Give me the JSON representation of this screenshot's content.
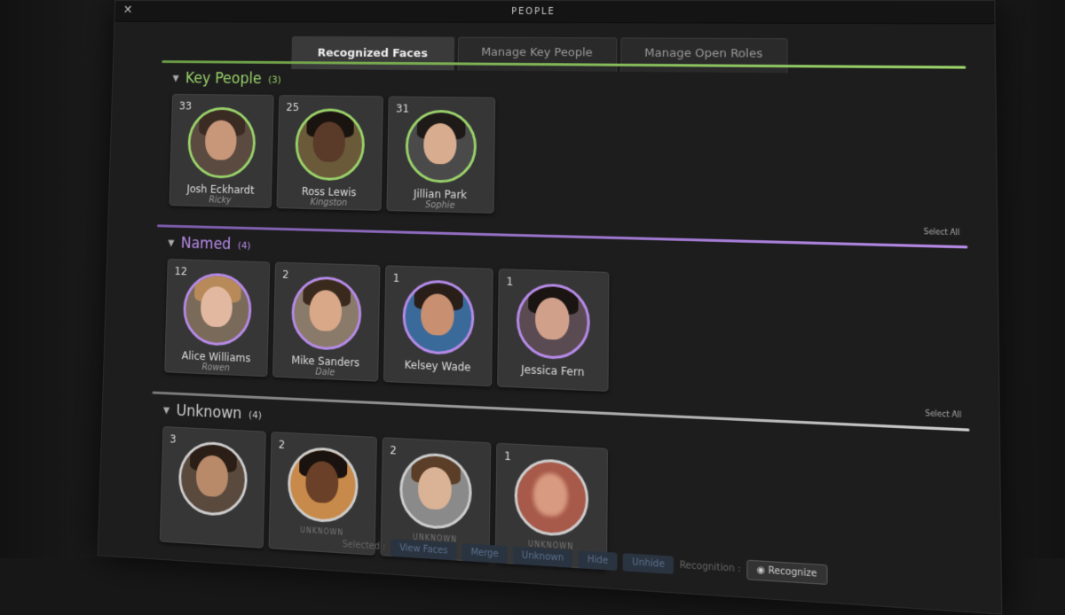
{
  "window": {
    "title": "PEOPLE",
    "close_label": "✕"
  },
  "tabs": [
    {
      "label": "Recognized Faces",
      "active": true
    },
    {
      "label": "Manage Key People",
      "active": false
    },
    {
      "label": "Manage Open Roles",
      "active": false
    }
  ],
  "sections": {
    "key_people": {
      "label": "Key People",
      "count": "(3)",
      "select_all": "Select All",
      "color": "#9ad36a",
      "cards": [
        {
          "count": "33",
          "name": "Josh Eckhardt",
          "alias": "Ricky"
        },
        {
          "count": "25",
          "name": "Ross Lewis",
          "alias": "Kingston"
        },
        {
          "count": "31",
          "name": "Jillian Park",
          "alias": "Sophie"
        }
      ]
    },
    "named": {
      "label": "Named",
      "count": "(4)",
      "select_all": "Select All",
      "color": "#b68ae8",
      "cards": [
        {
          "count": "12",
          "name": "Alice Williams",
          "alias": "Rowen"
        },
        {
          "count": "2",
          "name": "Mike Sanders",
          "alias": "Dale"
        },
        {
          "count": "1",
          "name": "Kelsey Wade",
          "alias": ""
        },
        {
          "count": "1",
          "name": "Jessica Fern",
          "alias": ""
        }
      ]
    },
    "unknown": {
      "label": "Unknown",
      "count": "(4)",
      "color": "#cccccc",
      "cards": [
        {
          "count": "3",
          "name": "",
          "alias": ""
        },
        {
          "count": "2",
          "name": "UNKNOWN",
          "alias": ""
        },
        {
          "count": "2",
          "name": "UNKNOWN",
          "alias": ""
        },
        {
          "count": "1",
          "name": "UNKNOWN",
          "alias": ""
        }
      ]
    }
  },
  "statusbar": {
    "selected_label": "Selected :",
    "buttons": [
      "View Faces",
      "Merge",
      "Unknown",
      "Hide",
      "Unhide"
    ],
    "recognition_label": "Recognition :",
    "recognize_label": "Recognize"
  },
  "colors": {
    "key_accent": "#9ad36a",
    "named_accent": "#b68ae8",
    "unknown_accent": "#cccccc"
  }
}
